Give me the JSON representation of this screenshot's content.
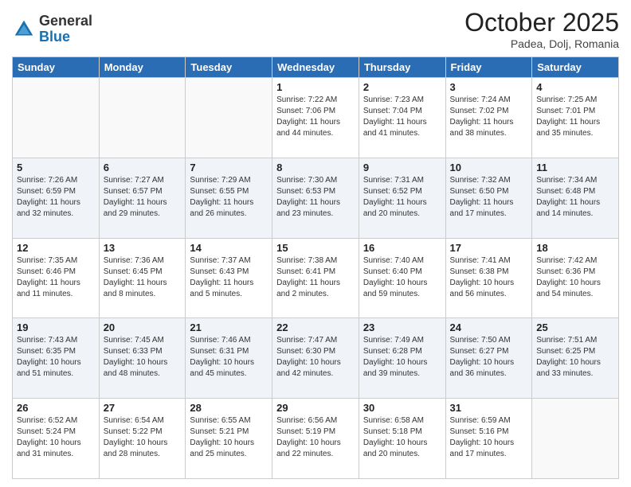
{
  "header": {
    "logo": {
      "general": "General",
      "blue": "Blue"
    },
    "title": "October 2025",
    "location": "Padea, Dolj, Romania"
  },
  "weekdays": [
    "Sunday",
    "Monday",
    "Tuesday",
    "Wednesday",
    "Thursday",
    "Friday",
    "Saturday"
  ],
  "weeks": [
    [
      {
        "day": "",
        "info": ""
      },
      {
        "day": "",
        "info": ""
      },
      {
        "day": "",
        "info": ""
      },
      {
        "day": "1",
        "info": "Sunrise: 7:22 AM\nSunset: 7:06 PM\nDaylight: 11 hours\nand 44 minutes."
      },
      {
        "day": "2",
        "info": "Sunrise: 7:23 AM\nSunset: 7:04 PM\nDaylight: 11 hours\nand 41 minutes."
      },
      {
        "day": "3",
        "info": "Sunrise: 7:24 AM\nSunset: 7:02 PM\nDaylight: 11 hours\nand 38 minutes."
      },
      {
        "day": "4",
        "info": "Sunrise: 7:25 AM\nSunset: 7:01 PM\nDaylight: 11 hours\nand 35 minutes."
      }
    ],
    [
      {
        "day": "5",
        "info": "Sunrise: 7:26 AM\nSunset: 6:59 PM\nDaylight: 11 hours\nand 32 minutes."
      },
      {
        "day": "6",
        "info": "Sunrise: 7:27 AM\nSunset: 6:57 PM\nDaylight: 11 hours\nand 29 minutes."
      },
      {
        "day": "7",
        "info": "Sunrise: 7:29 AM\nSunset: 6:55 PM\nDaylight: 11 hours\nand 26 minutes."
      },
      {
        "day": "8",
        "info": "Sunrise: 7:30 AM\nSunset: 6:53 PM\nDaylight: 11 hours\nand 23 minutes."
      },
      {
        "day": "9",
        "info": "Sunrise: 7:31 AM\nSunset: 6:52 PM\nDaylight: 11 hours\nand 20 minutes."
      },
      {
        "day": "10",
        "info": "Sunrise: 7:32 AM\nSunset: 6:50 PM\nDaylight: 11 hours\nand 17 minutes."
      },
      {
        "day": "11",
        "info": "Sunrise: 7:34 AM\nSunset: 6:48 PM\nDaylight: 11 hours\nand 14 minutes."
      }
    ],
    [
      {
        "day": "12",
        "info": "Sunrise: 7:35 AM\nSunset: 6:46 PM\nDaylight: 11 hours\nand 11 minutes."
      },
      {
        "day": "13",
        "info": "Sunrise: 7:36 AM\nSunset: 6:45 PM\nDaylight: 11 hours\nand 8 minutes."
      },
      {
        "day": "14",
        "info": "Sunrise: 7:37 AM\nSunset: 6:43 PM\nDaylight: 11 hours\nand 5 minutes."
      },
      {
        "day": "15",
        "info": "Sunrise: 7:38 AM\nSunset: 6:41 PM\nDaylight: 11 hours\nand 2 minutes."
      },
      {
        "day": "16",
        "info": "Sunrise: 7:40 AM\nSunset: 6:40 PM\nDaylight: 10 hours\nand 59 minutes."
      },
      {
        "day": "17",
        "info": "Sunrise: 7:41 AM\nSunset: 6:38 PM\nDaylight: 10 hours\nand 56 minutes."
      },
      {
        "day": "18",
        "info": "Sunrise: 7:42 AM\nSunset: 6:36 PM\nDaylight: 10 hours\nand 54 minutes."
      }
    ],
    [
      {
        "day": "19",
        "info": "Sunrise: 7:43 AM\nSunset: 6:35 PM\nDaylight: 10 hours\nand 51 minutes."
      },
      {
        "day": "20",
        "info": "Sunrise: 7:45 AM\nSunset: 6:33 PM\nDaylight: 10 hours\nand 48 minutes."
      },
      {
        "day": "21",
        "info": "Sunrise: 7:46 AM\nSunset: 6:31 PM\nDaylight: 10 hours\nand 45 minutes."
      },
      {
        "day": "22",
        "info": "Sunrise: 7:47 AM\nSunset: 6:30 PM\nDaylight: 10 hours\nand 42 minutes."
      },
      {
        "day": "23",
        "info": "Sunrise: 7:49 AM\nSunset: 6:28 PM\nDaylight: 10 hours\nand 39 minutes."
      },
      {
        "day": "24",
        "info": "Sunrise: 7:50 AM\nSunset: 6:27 PM\nDaylight: 10 hours\nand 36 minutes."
      },
      {
        "day": "25",
        "info": "Sunrise: 7:51 AM\nSunset: 6:25 PM\nDaylight: 10 hours\nand 33 minutes."
      }
    ],
    [
      {
        "day": "26",
        "info": "Sunrise: 6:52 AM\nSunset: 5:24 PM\nDaylight: 10 hours\nand 31 minutes."
      },
      {
        "day": "27",
        "info": "Sunrise: 6:54 AM\nSunset: 5:22 PM\nDaylight: 10 hours\nand 28 minutes."
      },
      {
        "day": "28",
        "info": "Sunrise: 6:55 AM\nSunset: 5:21 PM\nDaylight: 10 hours\nand 25 minutes."
      },
      {
        "day": "29",
        "info": "Sunrise: 6:56 AM\nSunset: 5:19 PM\nDaylight: 10 hours\nand 22 minutes."
      },
      {
        "day": "30",
        "info": "Sunrise: 6:58 AM\nSunset: 5:18 PM\nDaylight: 10 hours\nand 20 minutes."
      },
      {
        "day": "31",
        "info": "Sunrise: 6:59 AM\nSunset: 5:16 PM\nDaylight: 10 hours\nand 17 minutes."
      },
      {
        "day": "",
        "info": ""
      }
    ]
  ]
}
